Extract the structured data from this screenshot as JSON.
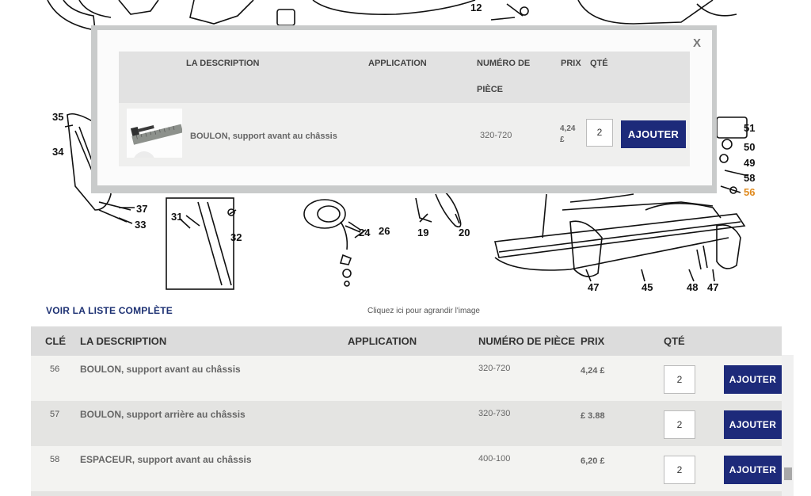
{
  "diagram": {
    "callouts": [
      "12",
      "35",
      "34",
      "37",
      "33",
      "31",
      "32",
      "24",
      "26",
      "19",
      "20",
      "51",
      "50",
      "49",
      "58",
      "56",
      "47",
      "45",
      "48",
      "47"
    ],
    "highlighted_callout": "56"
  },
  "links": {
    "view_full_list": "VOIR LA LISTE COMPLÈTE",
    "enlarge_image": "Cliquez ici pour agrandir l'image"
  },
  "table": {
    "headers": {
      "key": "CLÉ",
      "description": "LA DESCRIPTION",
      "application": "APPLICATION",
      "part_number": "NUMÉRO DE PIÈCE",
      "price": "PRIX",
      "qty": "QTÉ"
    },
    "rows": [
      {
        "key": "56",
        "description": "BOULON, support avant au châssis",
        "application": "",
        "part_number": "320-720",
        "price": "4,24 £",
        "qty": "2",
        "button": "AJOUTER"
      },
      {
        "key": "57",
        "description": "BOULON, support arrière au châssis",
        "application": "",
        "part_number": "320-730",
        "price": "£ 3.88",
        "qty": "2",
        "button": "AJOUTER"
      },
      {
        "key": "58",
        "description": "ESPACEUR, support avant au châssis",
        "application": "",
        "part_number": "400-100",
        "price": "6,20 £",
        "qty": "2",
        "button": "AJOUTER"
      }
    ]
  },
  "modal": {
    "close_label": "X",
    "headers": {
      "description": "LA DESCRIPTION",
      "application": "APPLICATION",
      "part_number_line1": "NUMÉRO DE",
      "part_number_line2": "PIÈCE",
      "price": "PRIX",
      "qty": "QTÉ"
    },
    "item": {
      "image_icon": "bolt-photo",
      "description": "BOULON, support avant au châssis",
      "part_number": "320-720",
      "price_line1": "4,24",
      "price_line2": "£",
      "qty": "2",
      "button": "AJOUTER"
    }
  },
  "colors": {
    "button": "#1d2a7a",
    "link": "#1d3173",
    "highlight_callout": "#e08a1e"
  }
}
